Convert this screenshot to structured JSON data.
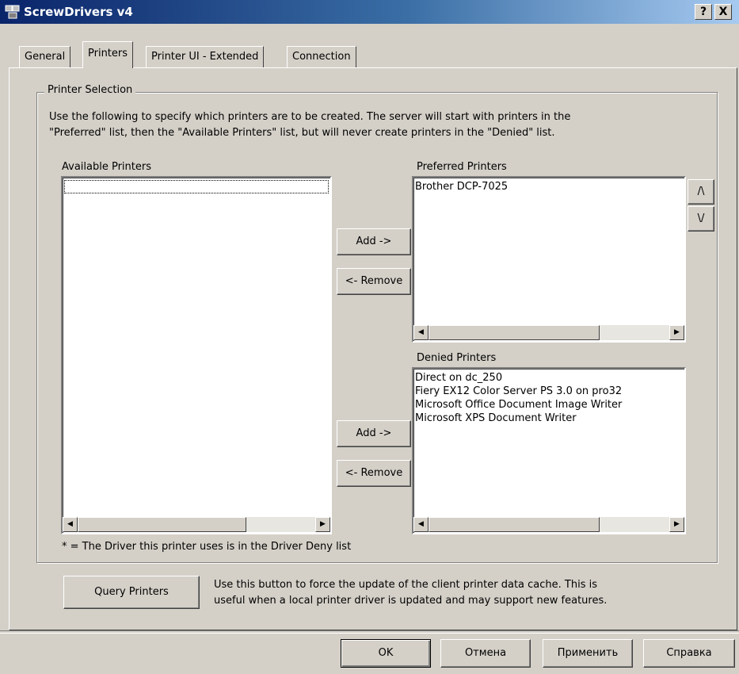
{
  "window": {
    "title": "ScrewDrivers v4",
    "help_label": "?",
    "close_label": "X"
  },
  "tabs": [
    {
      "label": "General",
      "active": false
    },
    {
      "label": "Printers",
      "active": true
    },
    {
      "label": "Printer UI - Extended",
      "active": false
    },
    {
      "label": "Connection",
      "active": false
    }
  ],
  "printer_selection": {
    "group_label": "Printer Selection",
    "description_line1": "Use the following to specify which printers are to be created.  The server will start with printers in the",
    "description_line2": "\"Preferred\" list, then the \"Available Printers\" list, but will never create printers in the \"Denied\" list.",
    "available_label": "Available Printers",
    "available_items": [],
    "preferred_label": "Preferred Printers",
    "preferred_items": [
      "Brother DCP-7025"
    ],
    "denied_label": "Denied Printers",
    "denied_items": [
      "Direct on dc_250",
      "Fiery EX12 Color Server PS 3.0 on pro32",
      "Microsoft Office Document Image Writer",
      "Microsoft XPS Document Writer"
    ],
    "add_label": "Add ->",
    "remove_label": "<- Remove",
    "move_up_label": "/\\",
    "move_down_label": "\\/",
    "footnote": "* = The Driver this printer uses is in the Driver Deny list"
  },
  "query": {
    "button_label": "Query Printers",
    "description_line1": "Use this button to force the update of the client printer data cache.  This is",
    "description_line2": "useful when a local printer driver is updated and may support new features."
  },
  "footer": {
    "ok_label": "OK",
    "cancel_label": "Отмена",
    "apply_label": "Применить",
    "help_label": "Справка"
  }
}
